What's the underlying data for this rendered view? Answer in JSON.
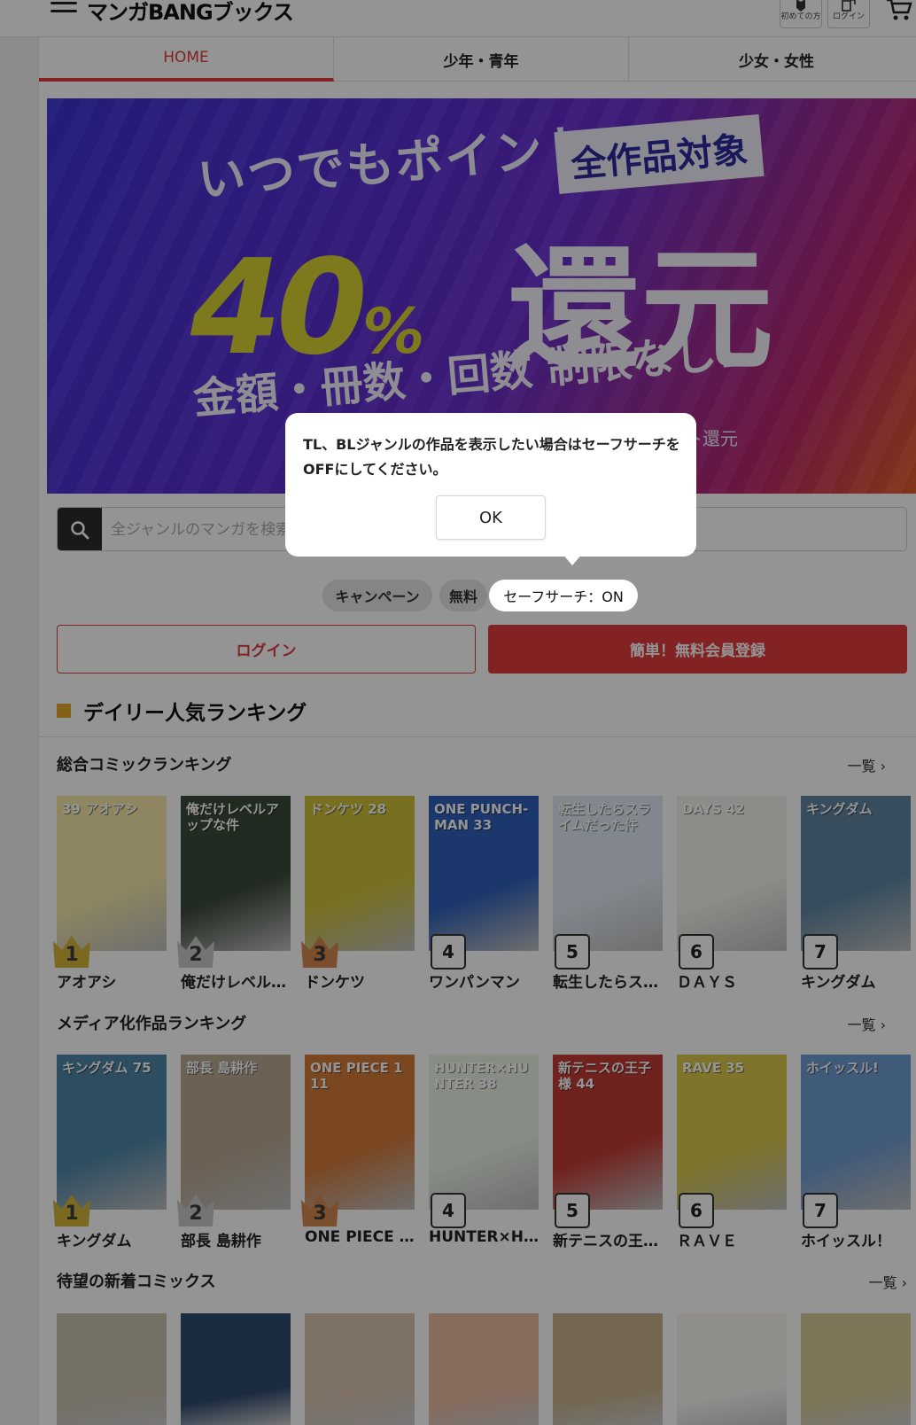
{
  "header": {
    "logo": "マンガBANGブックス",
    "beginner_label": "初めての方",
    "login_label": "ログイン"
  },
  "tabs": [
    {
      "label": "HOME"
    },
    {
      "label": "少年・青年"
    },
    {
      "label": "少女・女性"
    }
  ],
  "banner": {
    "line1": "いつでもポイント",
    "tag": "全作品対象",
    "percent": "40",
    "percent_sign": "%",
    "kanji": "還元",
    "line3": "金額・冊数・回数 制限なし!",
    "small": "ト還元"
  },
  "search": {
    "placeholder": "全ジャンルのマンガを検索"
  },
  "chips": {
    "campaign": "キャンペーン",
    "free": "無料",
    "safe_search": "セーフサーチ：ON"
  },
  "auth": {
    "login": "ログイン",
    "register": "簡単！無料会員登録"
  },
  "ranking": {
    "title": "デイリー人気ランキング",
    "more": "一覧 ›",
    "overall": {
      "title": "総合コミックランキング",
      "books": [
        {
          "rank": "1",
          "name": "アオアシ",
          "cover_text": "39 アオアシ",
          "color": "#f3e7a8"
        },
        {
          "rank": "2",
          "name": "俺だけレベル…",
          "cover_text": "俺だけレベルアップな件",
          "color": "#3c4a3a"
        },
        {
          "rank": "3",
          "name": "ドンケツ",
          "cover_text": "ドンケツ 28",
          "color": "#cfc23a"
        },
        {
          "rank": "4",
          "name": "ワンパンマン",
          "cover_text": "ONE PUNCH-MAN 33",
          "color": "#2f5fb8"
        },
        {
          "rank": "5",
          "name": "転生したらス…",
          "cover_text": "転生したらスライムだった件",
          "color": "#dfe8f2"
        },
        {
          "rank": "6",
          "name": "ＤＡＹＳ",
          "cover_text": "DAYS 42",
          "color": "#f4f1ea"
        },
        {
          "rank": "7",
          "name": "キングダム",
          "cover_text": "キングダム",
          "color": "#5f86a2"
        }
      ]
    },
    "media": {
      "title": "メディア化作品ランキング",
      "books": [
        {
          "rank": "1",
          "name": "キングダム",
          "cover_text": "キングダム 75",
          "color": "#4e86a8"
        },
        {
          "rank": "2",
          "name": "部長 島耕作",
          "cover_text": "部長 島耕作",
          "color": "#b9a892"
        },
        {
          "rank": "3",
          "name": "ONE PIECE …",
          "cover_text": "ONE PIECE 111",
          "color": "#d27a3a"
        },
        {
          "rank": "4",
          "name": "HUNTER×H…",
          "cover_text": "HUNTER×HUNTER 38",
          "color": "#e9f2e6"
        },
        {
          "rank": "5",
          "name": "新テニスの王…",
          "cover_text": "新テニスの王子様 44",
          "color": "#c23b35"
        },
        {
          "rank": "6",
          "name": "ＲＡＶＥ",
          "cover_text": "RAVE 35",
          "color": "#d9c94a"
        },
        {
          "rank": "7",
          "name": "ホイッスル！",
          "cover_text": "ホイッスル!",
          "color": "#6f9bd0"
        }
      ]
    }
  },
  "new_comics": {
    "title": "待望の新着コミックス",
    "more": "一覧 ›",
    "colors": [
      "#c9c1b0",
      "#2f4a6e",
      "#d9c4b2",
      "#e8b8a0",
      "#c7b28c",
      "#f7f4f0",
      "#d8cc9a"
    ]
  },
  "dialog": {
    "message": "TL、BLジャンルの作品を表示したい場合はセーフサーチをOFFにしてください。",
    "ok": "OK"
  },
  "colors": {
    "accent": "#e23b3b",
    "ranking_marker": "#e2a72a",
    "gold": "#d4b33a",
    "silver": "#c9c9c9",
    "bronze": "#d5894e"
  }
}
